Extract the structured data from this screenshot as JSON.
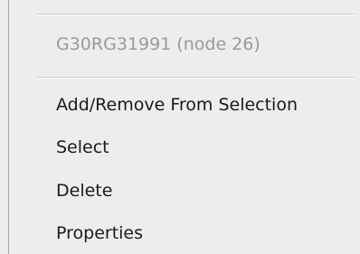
{
  "menu": {
    "header": "G30RG31991 (node 26)",
    "items": [
      {
        "label": "Add/Remove From Selection"
      },
      {
        "label": "Select"
      },
      {
        "label": "Delete"
      },
      {
        "label": "Properties"
      }
    ]
  }
}
